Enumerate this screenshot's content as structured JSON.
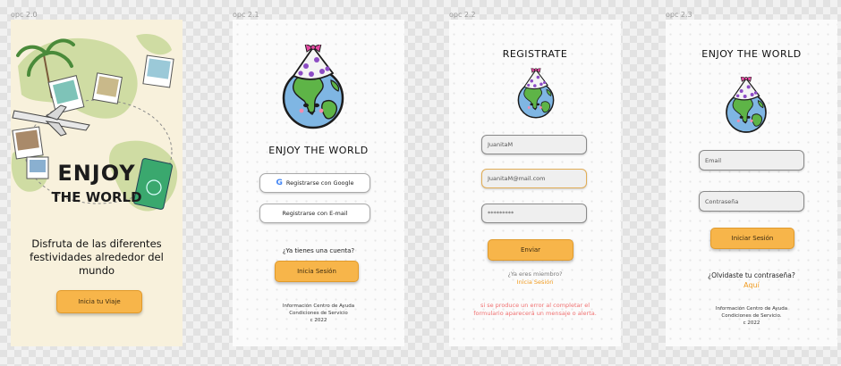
{
  "frames": [
    {
      "label": "opc 2.0",
      "logo_text": "ENJOY THE WORLD",
      "caption": "Disfruta de las diferentes festividades alrededor del mundo",
      "button": "Inicia tu Viaje"
    },
    {
      "label": "opc 2.1",
      "title": "ENJOY THE WORLD",
      "google_button": "Registrarse con Google",
      "email_button": "Registrarse con E-mail",
      "account_question": "¿Ya tienes una cuenta?",
      "login_button": "Inicia Sesión",
      "footer": [
        "Información Centro de Ayuda",
        "Condiciones de Servicio",
        "c 2022"
      ]
    },
    {
      "label": "opc 2.2",
      "title": "REGISTRATE",
      "username_value": "JuanitaM",
      "email_value": "JuanitaM@mail.com",
      "password_value": "*********",
      "submit_button": "Enviar",
      "member_question": "¿Ya eres miembro?",
      "login_link": "Inicia Sesión",
      "error_message": "si se produce un error al completar el formulario aparecerá un mensaje o alerta."
    },
    {
      "label": "opc 2.3",
      "title": "ENJOY THE WORLD",
      "email_placeholder": "Email",
      "password_placeholder": "Contraseña",
      "login_button": "Iniciar Sesión",
      "forgot_question": "¿Olvidaste tu contraseña?",
      "here_link": "Aquí",
      "footer": [
        "Información Centro de Ayuda",
        "Condiciones de Servicio.",
        "c 2022"
      ]
    }
  ],
  "colors": {
    "accent": "#f7b54a",
    "link": "#f09a1e",
    "error": "#f07070",
    "intro_bg": "#f8f1dc"
  }
}
